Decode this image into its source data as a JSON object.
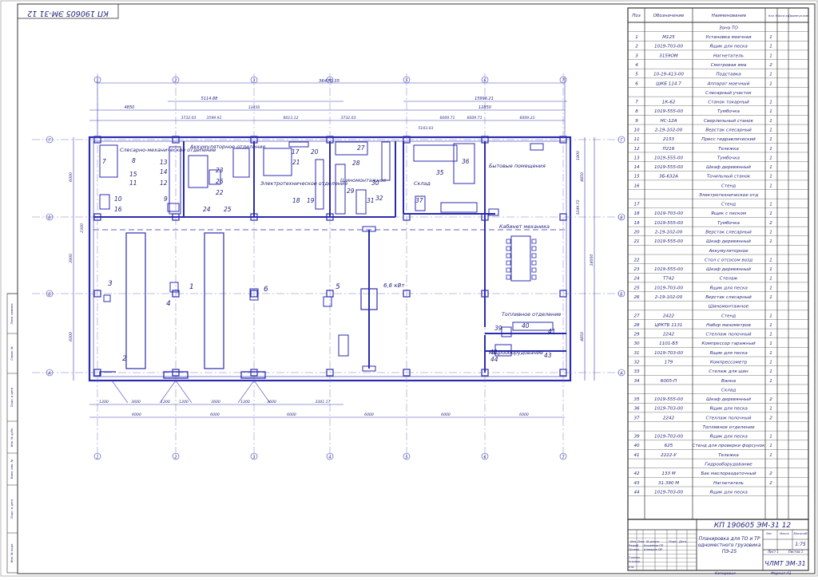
{
  "document": {
    "code": "КП 190605 ЭМ-31 12",
    "title_lines": [
      "Планировка для ТО и ТР",
      "одноместного грузовика",
      "ПЭ-25"
    ],
    "org": "ЧЛМТ ЭМ-31",
    "scale": "1:75",
    "sheet_label": "Лист 1",
    "sheets_label": "Листов 1",
    "col_labels": {
      "lit": "Лит.",
      "mass": "Масса",
      "scale": "Масштаб"
    },
    "format_label": "Формат А1",
    "copied_label": "Копировал",
    "stamp_labels": [
      "Изм",
      "Лист",
      "№ докум.",
      "Подп.",
      "Дата",
      "Разраб.",
      "Провер.",
      "Т.контр.",
      "Н.контр.",
      "Утв."
    ],
    "stamp_names": [
      "Кошейнов ПП",
      "Шамарин ПВ"
    ],
    "side_labels": [
      "Перв. примен.",
      "Справ. №",
      "Подп. и дата",
      "Инв. № дубл.",
      "Взам. инв. №",
      "Подп. и дата",
      "Инв. № подл."
    ]
  },
  "bom": {
    "headers": [
      "Поз",
      "Обозначение",
      "Наименование",
      "Кол",
      "Масса ед.",
      "Примеча-ние"
    ],
    "rows": [
      {
        "pos": "",
        "code": "",
        "name": "Зона ТО",
        "qty": "",
        "section": true
      },
      {
        "pos": "1",
        "code": "М125",
        "name": "Установка моечная",
        "qty": "1"
      },
      {
        "pos": "2",
        "code": "1019-703-00",
        "name": "Ящик для песка",
        "qty": "1"
      },
      {
        "pos": "3",
        "code": "3159ОМ",
        "name": "Нагнетатель",
        "qty": "1"
      },
      {
        "pos": "4",
        "code": "",
        "name": "Смотровая яма",
        "qty": "2"
      },
      {
        "pos": "5",
        "code": "10-19-413-00",
        "name": "Подставка",
        "qty": "1"
      },
      {
        "pos": "6",
        "code": "ШКБ 114.7",
        "name": "Аппарат моечный",
        "qty": "1"
      },
      {
        "pos": "",
        "code": "",
        "name": "Слесарный участок",
        "qty": "",
        "section": true
      },
      {
        "pos": "7",
        "code": "1К-62",
        "name": "Станок токарный",
        "qty": "1"
      },
      {
        "pos": "8",
        "code": "1019-555-00",
        "name": "Тумбочка",
        "qty": "1"
      },
      {
        "pos": "9",
        "code": "НС-12А",
        "name": "Сверлильный станок",
        "qty": "1"
      },
      {
        "pos": "10",
        "code": "2-19-102-00",
        "name": "Верстак слесарный",
        "qty": "1"
      },
      {
        "pos": "11",
        "code": "2153",
        "name": "Пресс гидравлический",
        "qty": "1"
      },
      {
        "pos": "12",
        "code": "П216",
        "name": "Тележка",
        "qty": "1"
      },
      {
        "pos": "13",
        "code": "1019-555-00",
        "name": "Тумбочка",
        "qty": "1"
      },
      {
        "pos": "14",
        "code": "1019-555-00",
        "name": "Шкаф деревянный",
        "qty": "1"
      },
      {
        "pos": "15",
        "code": "3Б-632А",
        "name": "Точильный станок",
        "qty": "1"
      },
      {
        "pos": "16",
        "code": "",
        "name": "Стенд",
        "qty": "1"
      },
      {
        "pos": "",
        "code": "",
        "name": "Электротехническое отд",
        "qty": "",
        "section": true
      },
      {
        "pos": "17",
        "code": "",
        "name": "Стенд",
        "qty": "1"
      },
      {
        "pos": "18",
        "code": "1019-703-00",
        "name": "Ящик с песком",
        "qty": "1"
      },
      {
        "pos": "19",
        "code": "1019-555-00",
        "name": "Тумбочка",
        "qty": "2"
      },
      {
        "pos": "20",
        "code": "2-19-102-00",
        "name": "Верстак слесарный",
        "qty": "1"
      },
      {
        "pos": "21",
        "code": "1019-555-00",
        "name": "Шкаф деревянный",
        "qty": "1"
      },
      {
        "pos": "",
        "code": "",
        "name": "Аккумуляторное",
        "qty": "",
        "section": true
      },
      {
        "pos": "22",
        "code": "",
        "name": "Стол с отсосом возд",
        "qty": "1"
      },
      {
        "pos": "23",
        "code": "1019-555-00",
        "name": "Шкаф деревянный",
        "qty": "1"
      },
      {
        "pos": "24",
        "code": "Т742",
        "name": "Стелаж",
        "qty": "1"
      },
      {
        "pos": "25",
        "code": "1019-703-00",
        "name": "Ящик для песка",
        "qty": "1"
      },
      {
        "pos": "26",
        "code": "2-19-102-00",
        "name": "Верстак слесарный",
        "qty": "1"
      },
      {
        "pos": "",
        "code": "",
        "name": "Шиномонтажное",
        "qty": "",
        "section": true
      },
      {
        "pos": "27",
        "code": "2422",
        "name": "Стенд",
        "qty": "1"
      },
      {
        "pos": "28",
        "code": "ЦРКТБ 1131",
        "name": "Набор манометров",
        "qty": "1"
      },
      {
        "pos": "29",
        "code": "2242",
        "name": "Стеллаж полочный",
        "qty": "1"
      },
      {
        "pos": "30",
        "code": "1101-Б5",
        "name": "Компрессор гаражный",
        "qty": "1"
      },
      {
        "pos": "31",
        "code": "1019-703-00",
        "name": "Ящик для песка",
        "qty": "1"
      },
      {
        "pos": "32",
        "code": "179",
        "name": "Компрессометр",
        "qty": "1"
      },
      {
        "pos": "33",
        "code": "",
        "name": "Стелаж для шин",
        "qty": "1"
      },
      {
        "pos": "34",
        "code": "6005-П",
        "name": "Ванна",
        "qty": "1"
      },
      {
        "pos": "",
        "code": "",
        "name": "Склад",
        "qty": "",
        "section": true
      },
      {
        "pos": "35",
        "code": "1019-555-00",
        "name": "Шкаф деревянный",
        "qty": "2"
      },
      {
        "pos": "36",
        "code": "1019-703-00",
        "name": "Ящик для песка",
        "qty": "1"
      },
      {
        "pos": "37",
        "code": "2242",
        "name": "Стеллаж полочный",
        "qty": "2"
      },
      {
        "pos": "",
        "code": "",
        "name": "Топливное отделение",
        "qty": "",
        "section": true
      },
      {
        "pos": "39",
        "code": "1019-703-00",
        "name": "Ящик для песка",
        "qty": "1"
      },
      {
        "pos": "40",
        "code": "625",
        "name": "Стенд для проверки форсунок",
        "qty": "1"
      },
      {
        "pos": "41",
        "code": "2222-У",
        "name": "Тележка",
        "qty": "1"
      },
      {
        "pos": "",
        "code": "",
        "name": "Гидрооборудование",
        "qty": "",
        "section": true
      },
      {
        "pos": "42",
        "code": "133 М",
        "name": "Бак маслораздаточный",
        "qty": "2"
      },
      {
        "pos": "43",
        "code": "31.390 М",
        "name": "Нагнетатель",
        "qty": "2"
      },
      {
        "pos": "44",
        "code": "1019-703-00",
        "name": "Ящик для песка",
        "qty": ""
      }
    ]
  },
  "plan": {
    "axes_letters": [
      "Г",
      "В",
      "Б",
      "А"
    ],
    "axes_numbers": [
      "1",
      "2",
      "3",
      "4",
      "5",
      "6",
      "7"
    ],
    "overall_dim": "36470.35",
    "bay_dim": "6000",
    "rooms": [
      "Слесарно-механическое отделение",
      "Аккумуляторное отделение",
      "Электротехническое отделение",
      "Шиномонтажное",
      "Склад",
      "Бытовые помещения",
      "Кабинет механика",
      "Топливное отделение",
      "Гидрооборудование"
    ],
    "power_label": "6,6 кВт",
    "items": [
      "1",
      "2",
      "3",
      "4",
      "5",
      "6",
      "7",
      "8",
      "9",
      "10",
      "11",
      "12",
      "13",
      "14",
      "15",
      "16",
      "17",
      "18",
      "19",
      "20",
      "21",
      "22",
      "23",
      "24",
      "25",
      "26",
      "27",
      "28",
      "29",
      "30",
      "31",
      "32",
      "35",
      "36",
      "37",
      "39",
      "40",
      "41",
      "42",
      "43",
      "44"
    ],
    "top_dims": [
      "4850",
      "5114.88",
      "5114.88",
      "15996.21",
      "12850"
    ],
    "sub_dims": [
      "3732.03",
      "3599.91",
      "12450",
      "6013.12",
      "3732.03",
      "5103.03",
      "6009.71",
      "6009.71",
      "6009.23"
    ],
    "bottom_dims": [
      "1200",
      "3600",
      "1200",
      "1200",
      "3600",
      "1200",
      "3600",
      "3301.17"
    ],
    "side_dims": [
      "6000",
      "2300",
      "3900",
      "6000",
      "4850",
      "18000",
      "4850",
      "1800",
      "3249.72"
    ]
  }
}
